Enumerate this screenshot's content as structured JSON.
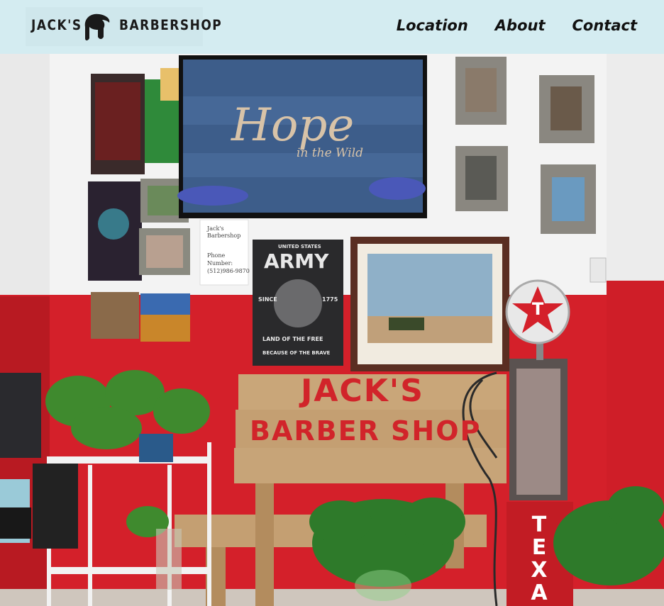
{
  "brand": {
    "left_word": "JACK'S",
    "right_word": "BARBERSHOP",
    "logo_icon": "barber-hair-silhouette-icon"
  },
  "nav": {
    "items": [
      "Location",
      "About",
      "Contact"
    ]
  },
  "hero": {
    "tv_title": "Hope",
    "tv_subtitle": "in the Wild",
    "note_lines": [
      "Jack's",
      "Barbershop",
      "",
      "Phone",
      "Number:",
      "(512)986-9870"
    ],
    "army_poster": {
      "top": "UNITED STATES",
      "title": "ARMY",
      "since": "SINCE",
      "year": "1775",
      "banner1": "LAND OF THE FREE",
      "banner2": "BECAUSE OF THE BRAVE"
    },
    "sign_line1": "JACK'S",
    "sign_line2": "BARBER SHOP",
    "pump_letters": [
      "T",
      "E",
      "X",
      "A"
    ],
    "pump_globe_letter": "T"
  },
  "colors": {
    "header_bg": "#d4ecf1",
    "wall_red": "#d4202a",
    "wall_white": "#f4f4f4"
  }
}
